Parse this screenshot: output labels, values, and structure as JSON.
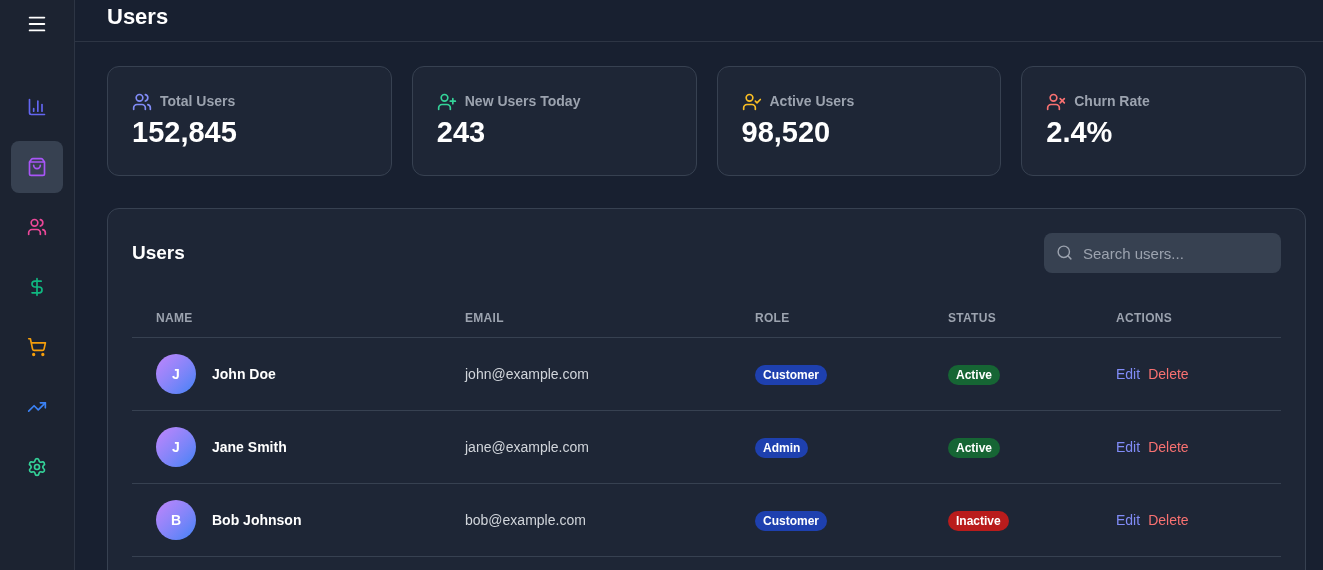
{
  "sidebar": {
    "items": [
      {
        "selected": false,
        "color": "#6366f1"
      },
      {
        "selected": true,
        "color": "#a855f7"
      },
      {
        "selected": false,
        "color": "#ec4899"
      },
      {
        "selected": false,
        "color": "#10b981"
      },
      {
        "selected": false,
        "color": "#f59e0b"
      },
      {
        "selected": false,
        "color": "#3b82f6"
      },
      {
        "selected": false,
        "color": "#34d399"
      }
    ]
  },
  "header": {
    "title": "Users"
  },
  "stats": [
    {
      "label": "Total Users",
      "value": "152,845",
      "color": "#818cf8"
    },
    {
      "label": "New Users Today",
      "value": "243",
      "color": "#34d399"
    },
    {
      "label": "Active Users",
      "value": "98,520",
      "color": "#fbbf24"
    },
    {
      "label": "Churn Rate",
      "value": "2.4%",
      "color": "#f87171"
    }
  ],
  "users_table": {
    "title": "Users",
    "search": {
      "placeholder": "Search users..."
    },
    "columns": [
      "NAME",
      "EMAIL",
      "ROLE",
      "STATUS",
      "ACTIONS"
    ],
    "rows": [
      {
        "initial": "J",
        "name": "John Doe",
        "email": "john@example.com",
        "role": "Customer",
        "status": "Active",
        "kind": "active",
        "actions": [
          "Edit",
          "Delete"
        ]
      },
      {
        "initial": "J",
        "name": "Jane Smith",
        "email": "jane@example.com",
        "role": "Admin",
        "status": "Active",
        "kind": "active",
        "actions": [
          "Edit",
          "Delete"
        ]
      },
      {
        "initial": "B",
        "name": "Bob Johnson",
        "email": "bob@example.com",
        "role": "Customer",
        "status": "Inactive",
        "kind": "inactive",
        "actions": [
          "Edit",
          "Delete"
        ]
      }
    ]
  }
}
